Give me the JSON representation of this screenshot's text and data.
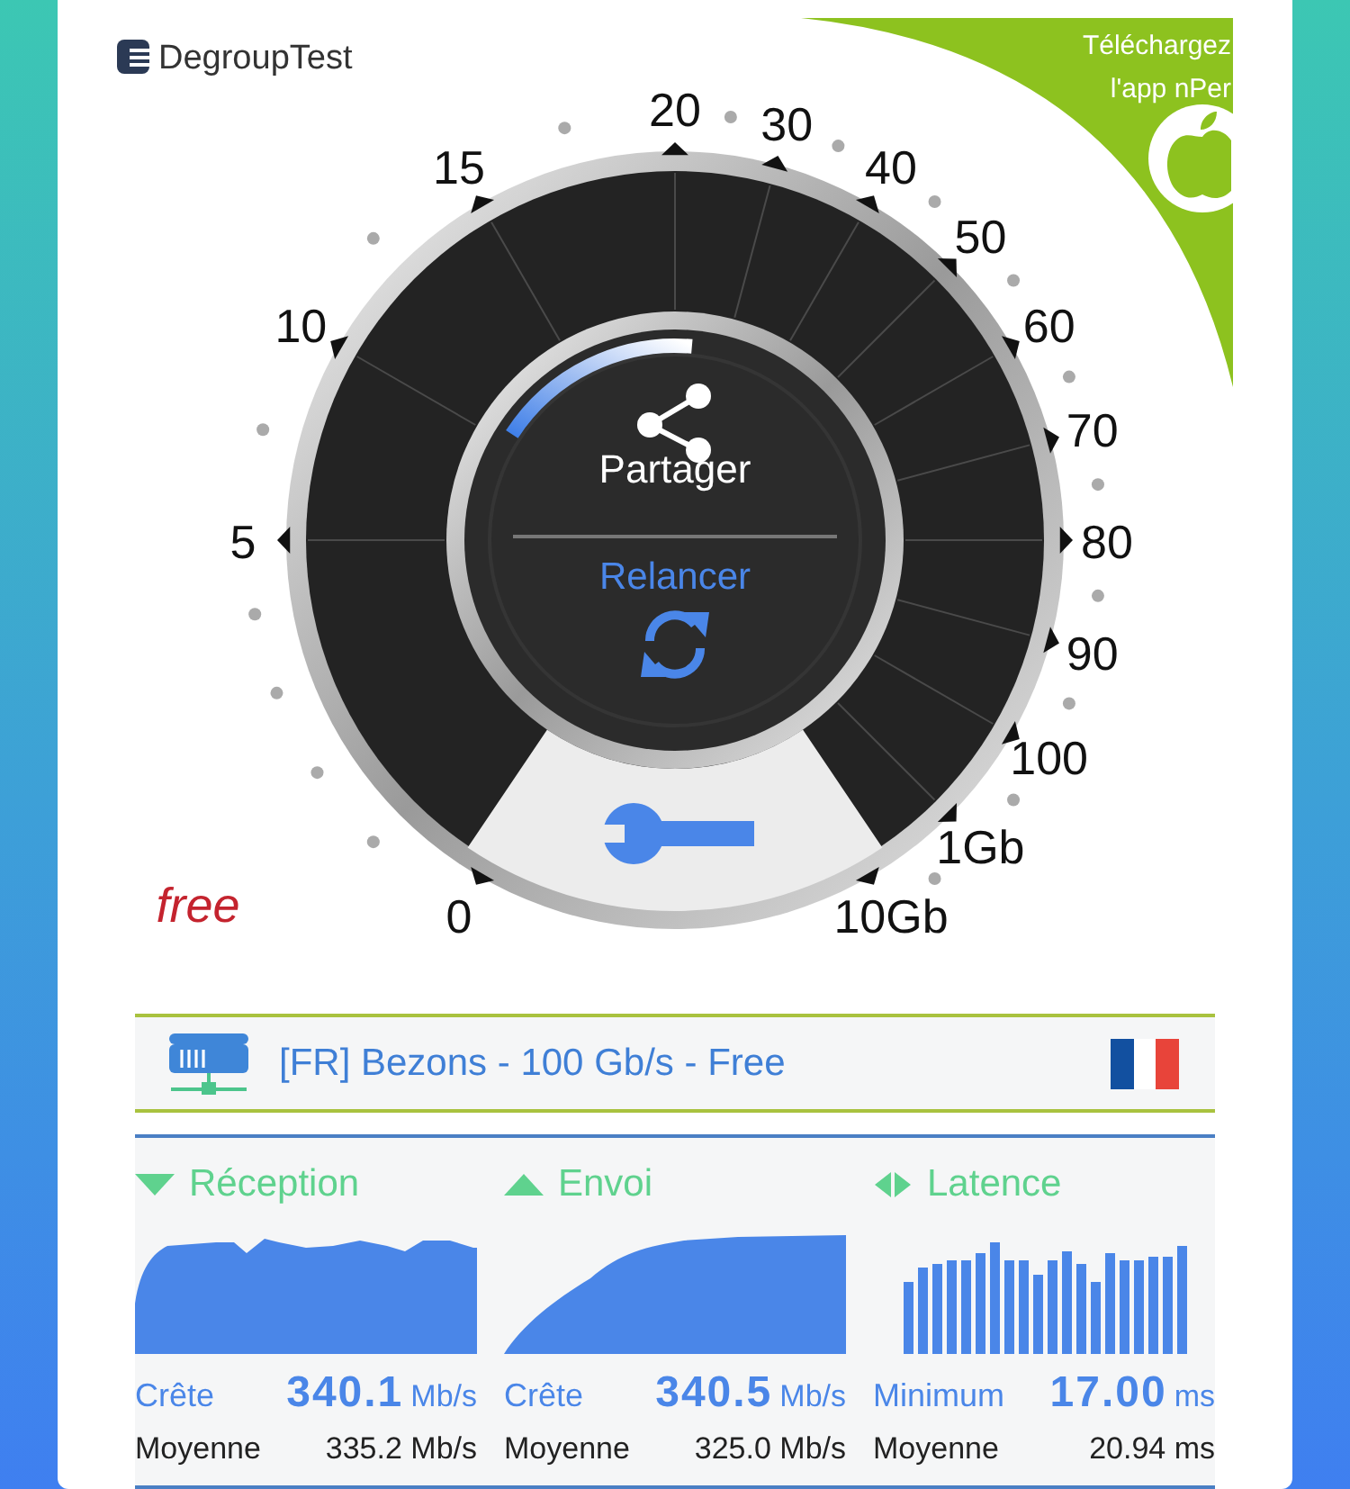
{
  "brand": {
    "name": "DegroupTest"
  },
  "promo": {
    "lines": [
      "Téléchargez",
      "l'app nPer"
    ]
  },
  "gauge": {
    "scale": [
      {
        "label": "0"
      },
      {
        "label": "5"
      },
      {
        "label": "10"
      },
      {
        "label": "15"
      },
      {
        "label": "20"
      },
      {
        "label": "30"
      },
      {
        "label": "40"
      },
      {
        "label": "50"
      },
      {
        "label": "60"
      },
      {
        "label": "70"
      },
      {
        "label": "80"
      },
      {
        "label": "90"
      },
      {
        "label": "100"
      },
      {
        "label": "1Gb"
      },
      {
        "label": "10Gb"
      }
    ],
    "share_label": "Partager",
    "restart_label": "Relancer"
  },
  "isp_logo": "free",
  "server": {
    "name": "[FR] Bezons - 100 Gb/s - Free"
  },
  "stats": [
    {
      "kind": "download",
      "title": "Réception",
      "peak_label": "Crête",
      "peak_value": "340.1",
      "peak_unit": "Mb/s",
      "avg_label": "Moyenne",
      "avg_value": "335.2 Mb/s"
    },
    {
      "kind": "upload",
      "title": "Envoi",
      "peak_label": "Crête",
      "peak_value": "340.5",
      "peak_unit": "Mb/s",
      "avg_label": "Moyenne",
      "avg_value": "325.0 Mb/s"
    },
    {
      "kind": "latency",
      "title": "Latence",
      "peak_label": "Minimum",
      "peak_value": "17.00",
      "peak_unit": "ms",
      "avg_label": "Moyenne",
      "avg_value": "20.94 ms"
    }
  ]
}
